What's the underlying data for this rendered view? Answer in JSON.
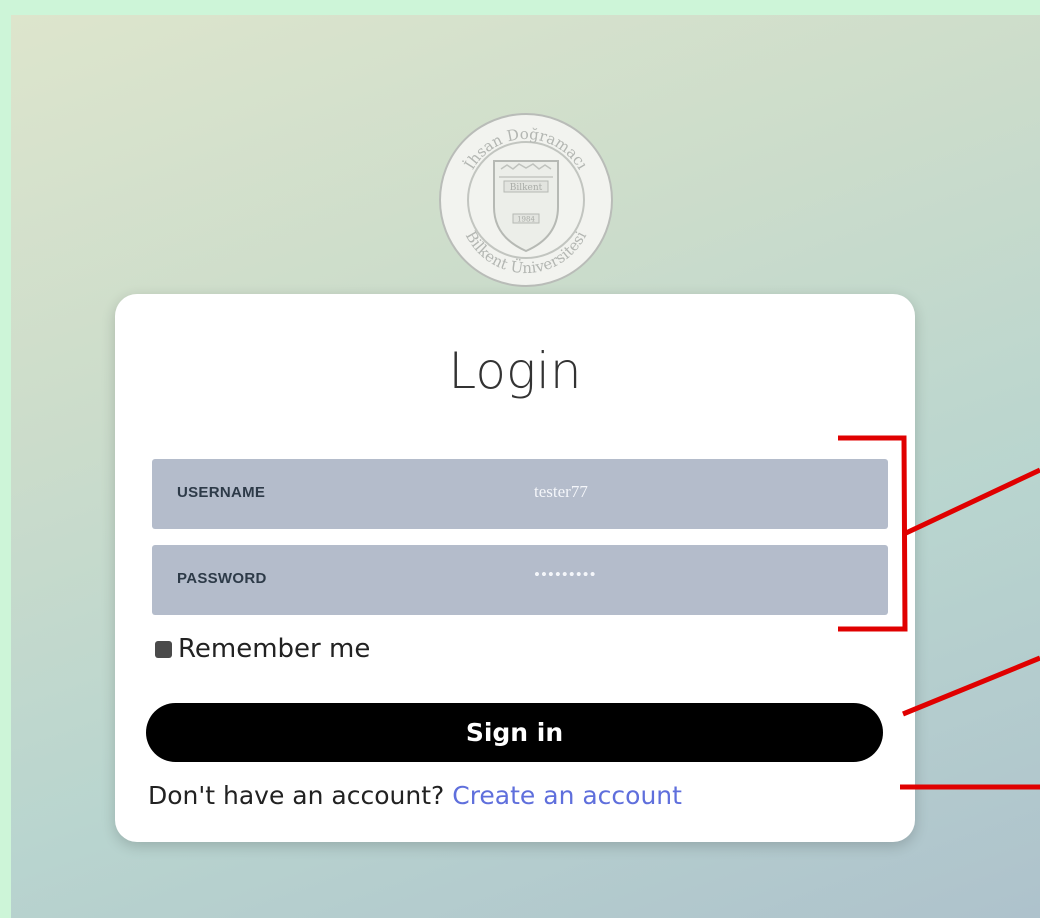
{
  "seal": {
    "text_top": "İhsan Doğramacı",
    "text_bottom": "Bilkent Üniversitesi",
    "emblem_text": "Bilkent",
    "year": "1984"
  },
  "login": {
    "title": "Login",
    "username_label": "USERNAME",
    "username_value": "tester77",
    "password_label": "PASSWORD",
    "password_value": "•••••••••",
    "remember_label": "Remember me",
    "remember_checked": true,
    "signin_label": "Sign in",
    "no_account_text": "Don't have an account?",
    "create_account_link": "Create an account"
  },
  "colors": {
    "field_bg": "#b4bccb",
    "button_bg": "#000000",
    "link": "#5f6fdc",
    "annotation": "#e00000"
  }
}
